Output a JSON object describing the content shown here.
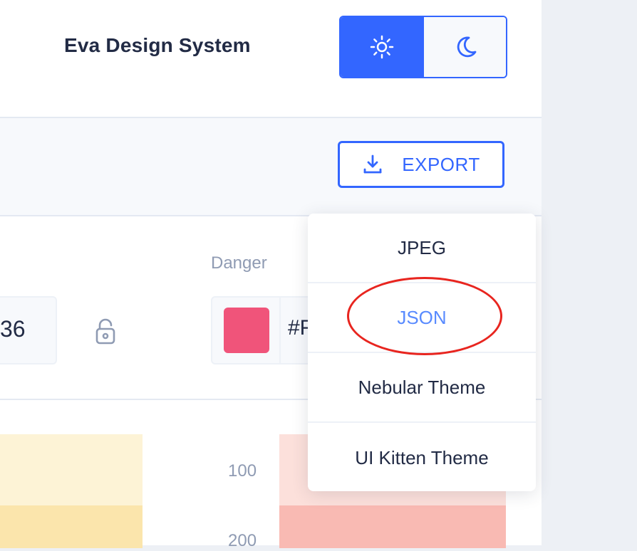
{
  "header": {
    "brand": "Eva Design System",
    "theme_toggle": {
      "options": [
        "light",
        "dark"
      ],
      "selected": "light"
    }
  },
  "toolbar": {
    "export_label": "EXPORT"
  },
  "colors": {
    "partial_value_left": "36",
    "danger": {
      "label": "Danger",
      "hex_partial": "#F",
      "swatch_color": "#f0547a"
    }
  },
  "palette": {
    "shades": [
      "100",
      "200"
    ],
    "yellow": [
      "#fdf3d6",
      "#fbe5ac"
    ],
    "red": [
      "#fce0db",
      "#f9bab3"
    ]
  },
  "export_menu": {
    "items": [
      "JPEG",
      "JSON",
      "Nebular Theme",
      "UI Kitten Theme"
    ],
    "highlighted": "JSON"
  },
  "accent_color": "#3366ff"
}
